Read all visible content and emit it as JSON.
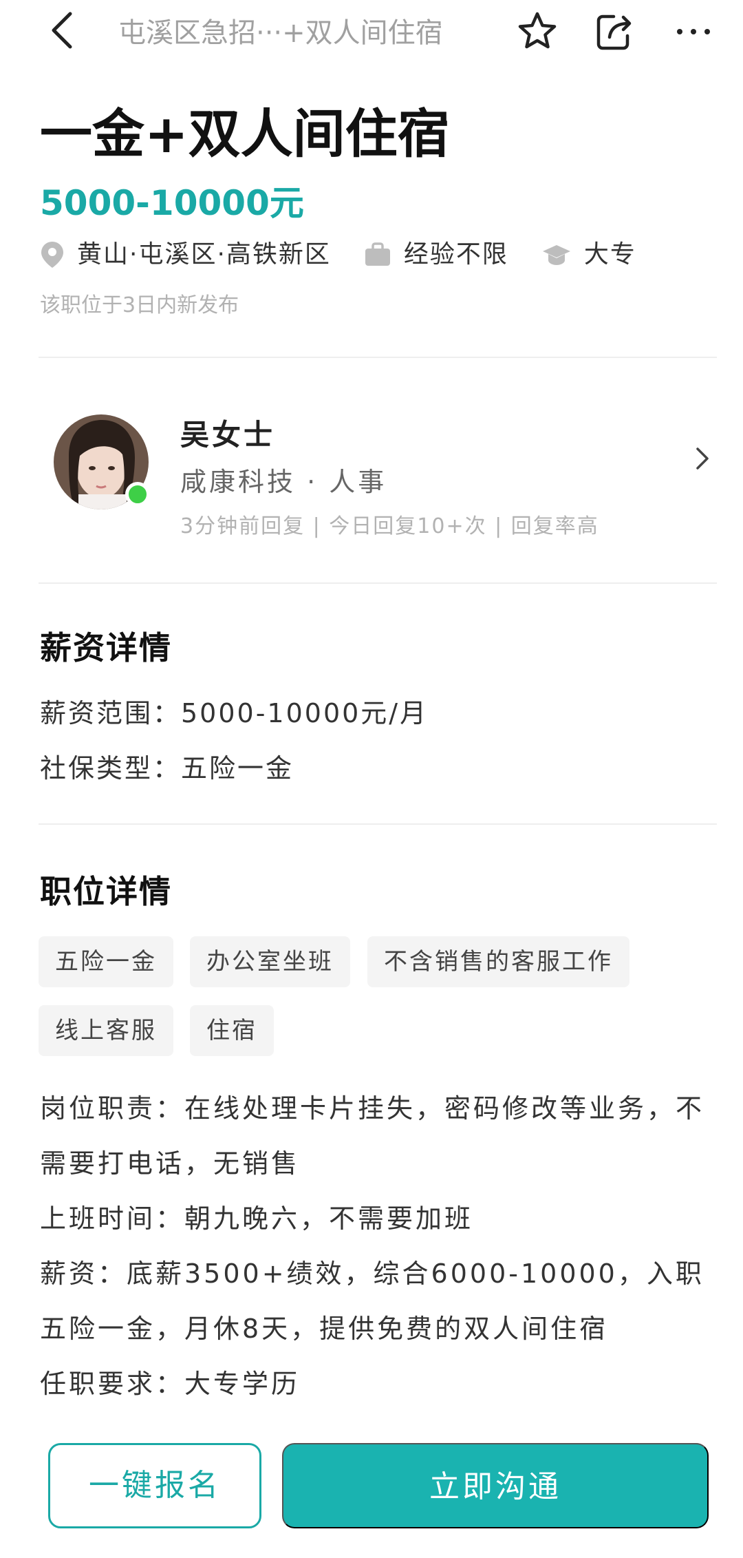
{
  "nav": {
    "title": "屯溪区急招···+双人间住宿"
  },
  "job": {
    "title": "一金+双人间住宿",
    "salary": "5000-10000元",
    "location": "黄山·屯溪区·高铁新区",
    "experience": "经验不限",
    "education": "大专",
    "posted": "该职位于3日内新发布"
  },
  "recruiter": {
    "name": "吴女士",
    "company_role": "咸康科技 · 人事",
    "stats": "3分钟前回复 | 今日回复10+次 | 回复率高"
  },
  "salary_section": {
    "title": "薪资详情",
    "range": "薪资范围：5000-10000元/月",
    "insurance": "社保类型：五险一金"
  },
  "position_section": {
    "title": "职位详情",
    "tags": [
      "五险一金",
      "办公室坐班",
      "不含销售的客服工作",
      "线上客服",
      "住宿"
    ],
    "duties": "岗位职责：在线处理卡片挂失，密码修改等业务，不需要打电话，无销售",
    "hours": "上班时间：朝九晚六，不需要加班",
    "pay": "薪资：底薪3500+绩效，综合6000-10000，入职五险一金，月休8天，提供免费的双人间住宿",
    "requirements": "任职要求：大专学历"
  },
  "actions": {
    "signup_label": "一键报名",
    "chat_label": "立即沟通"
  },
  "colors": {
    "accent": "#1aa9a6",
    "online": "#3ecf47"
  }
}
